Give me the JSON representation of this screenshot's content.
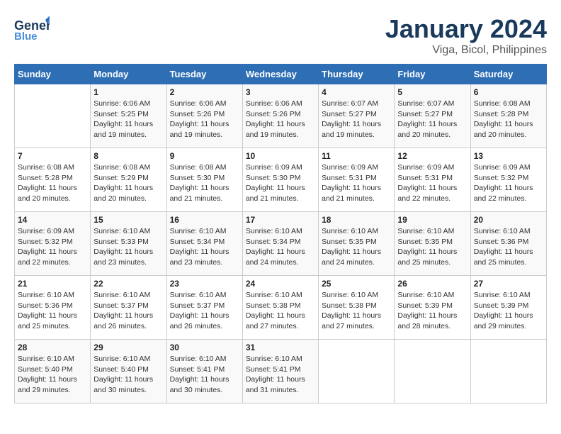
{
  "header": {
    "logo_general": "General",
    "logo_blue": "Blue",
    "month": "January 2024",
    "location": "Viga, Bicol, Philippines"
  },
  "weekdays": [
    "Sunday",
    "Monday",
    "Tuesday",
    "Wednesday",
    "Thursday",
    "Friday",
    "Saturday"
  ],
  "weeks": [
    [
      {
        "num": "",
        "info": ""
      },
      {
        "num": "1",
        "info": "Sunrise: 6:06 AM\nSunset: 5:25 PM\nDaylight: 11 hours\nand 19 minutes."
      },
      {
        "num": "2",
        "info": "Sunrise: 6:06 AM\nSunset: 5:26 PM\nDaylight: 11 hours\nand 19 minutes."
      },
      {
        "num": "3",
        "info": "Sunrise: 6:06 AM\nSunset: 5:26 PM\nDaylight: 11 hours\nand 19 minutes."
      },
      {
        "num": "4",
        "info": "Sunrise: 6:07 AM\nSunset: 5:27 PM\nDaylight: 11 hours\nand 19 minutes."
      },
      {
        "num": "5",
        "info": "Sunrise: 6:07 AM\nSunset: 5:27 PM\nDaylight: 11 hours\nand 20 minutes."
      },
      {
        "num": "6",
        "info": "Sunrise: 6:08 AM\nSunset: 5:28 PM\nDaylight: 11 hours\nand 20 minutes."
      }
    ],
    [
      {
        "num": "7",
        "info": "Sunrise: 6:08 AM\nSunset: 5:28 PM\nDaylight: 11 hours\nand 20 minutes."
      },
      {
        "num": "8",
        "info": "Sunrise: 6:08 AM\nSunset: 5:29 PM\nDaylight: 11 hours\nand 20 minutes."
      },
      {
        "num": "9",
        "info": "Sunrise: 6:08 AM\nSunset: 5:30 PM\nDaylight: 11 hours\nand 21 minutes."
      },
      {
        "num": "10",
        "info": "Sunrise: 6:09 AM\nSunset: 5:30 PM\nDaylight: 11 hours\nand 21 minutes."
      },
      {
        "num": "11",
        "info": "Sunrise: 6:09 AM\nSunset: 5:31 PM\nDaylight: 11 hours\nand 21 minutes."
      },
      {
        "num": "12",
        "info": "Sunrise: 6:09 AM\nSunset: 5:31 PM\nDaylight: 11 hours\nand 22 minutes."
      },
      {
        "num": "13",
        "info": "Sunrise: 6:09 AM\nSunset: 5:32 PM\nDaylight: 11 hours\nand 22 minutes."
      }
    ],
    [
      {
        "num": "14",
        "info": "Sunrise: 6:09 AM\nSunset: 5:32 PM\nDaylight: 11 hours\nand 22 minutes."
      },
      {
        "num": "15",
        "info": "Sunrise: 6:10 AM\nSunset: 5:33 PM\nDaylight: 11 hours\nand 23 minutes."
      },
      {
        "num": "16",
        "info": "Sunrise: 6:10 AM\nSunset: 5:34 PM\nDaylight: 11 hours\nand 23 minutes."
      },
      {
        "num": "17",
        "info": "Sunrise: 6:10 AM\nSunset: 5:34 PM\nDaylight: 11 hours\nand 24 minutes."
      },
      {
        "num": "18",
        "info": "Sunrise: 6:10 AM\nSunset: 5:35 PM\nDaylight: 11 hours\nand 24 minutes."
      },
      {
        "num": "19",
        "info": "Sunrise: 6:10 AM\nSunset: 5:35 PM\nDaylight: 11 hours\nand 25 minutes."
      },
      {
        "num": "20",
        "info": "Sunrise: 6:10 AM\nSunset: 5:36 PM\nDaylight: 11 hours\nand 25 minutes."
      }
    ],
    [
      {
        "num": "21",
        "info": "Sunrise: 6:10 AM\nSunset: 5:36 PM\nDaylight: 11 hours\nand 25 minutes."
      },
      {
        "num": "22",
        "info": "Sunrise: 6:10 AM\nSunset: 5:37 PM\nDaylight: 11 hours\nand 26 minutes."
      },
      {
        "num": "23",
        "info": "Sunrise: 6:10 AM\nSunset: 5:37 PM\nDaylight: 11 hours\nand 26 minutes."
      },
      {
        "num": "24",
        "info": "Sunrise: 6:10 AM\nSunset: 5:38 PM\nDaylight: 11 hours\nand 27 minutes."
      },
      {
        "num": "25",
        "info": "Sunrise: 6:10 AM\nSunset: 5:38 PM\nDaylight: 11 hours\nand 27 minutes."
      },
      {
        "num": "26",
        "info": "Sunrise: 6:10 AM\nSunset: 5:39 PM\nDaylight: 11 hours\nand 28 minutes."
      },
      {
        "num": "27",
        "info": "Sunrise: 6:10 AM\nSunset: 5:39 PM\nDaylight: 11 hours\nand 29 minutes."
      }
    ],
    [
      {
        "num": "28",
        "info": "Sunrise: 6:10 AM\nSunset: 5:40 PM\nDaylight: 11 hours\nand 29 minutes."
      },
      {
        "num": "29",
        "info": "Sunrise: 6:10 AM\nSunset: 5:40 PM\nDaylight: 11 hours\nand 30 minutes."
      },
      {
        "num": "30",
        "info": "Sunrise: 6:10 AM\nSunset: 5:41 PM\nDaylight: 11 hours\nand 30 minutes."
      },
      {
        "num": "31",
        "info": "Sunrise: 6:10 AM\nSunset: 5:41 PM\nDaylight: 11 hours\nand 31 minutes."
      },
      {
        "num": "",
        "info": ""
      },
      {
        "num": "",
        "info": ""
      },
      {
        "num": "",
        "info": ""
      }
    ]
  ]
}
